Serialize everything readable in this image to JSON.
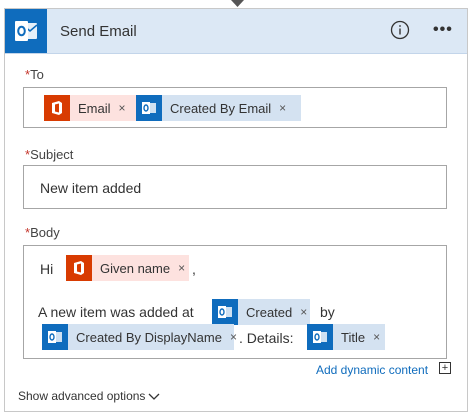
{
  "header": {
    "title": "Send Email",
    "info_icon": "info-icon",
    "more_icon": "more-icon",
    "app_icon": "outlook-icon",
    "accent": "#0f6cbd"
  },
  "fields": {
    "to": {
      "label": "To",
      "required_mark": "*",
      "tokens": [
        {
          "label": "Email",
          "source": "office-365",
          "remove": "×"
        },
        {
          "label": "Created By Email",
          "source": "outlook",
          "remove": "×"
        }
      ]
    },
    "subject": {
      "label": "Subject",
      "required_mark": "*",
      "value": "New item added"
    },
    "body": {
      "label": "Body",
      "required_mark": "*",
      "line1": {
        "prefix": "Hi",
        "token": "Given name",
        "suffix": ","
      },
      "line2": {
        "prefix": "A new item was added at",
        "token": "Created",
        "suffix": "by"
      },
      "line3": {
        "token1": "Created By DisplayName",
        "middle": ". Details:",
        "token2": "Title"
      },
      "remove": "×"
    }
  },
  "footer": {
    "add_dynamic": "Add dynamic content",
    "plus": "+",
    "show_advanced": "Show advanced options"
  },
  "colors": {
    "office": "#d83b01",
    "office_token_bg": "#fde2df",
    "outlook": "#0f6cbd",
    "outlook_token_bg": "#d4e2f1",
    "header_bg": "#dce8f5"
  }
}
